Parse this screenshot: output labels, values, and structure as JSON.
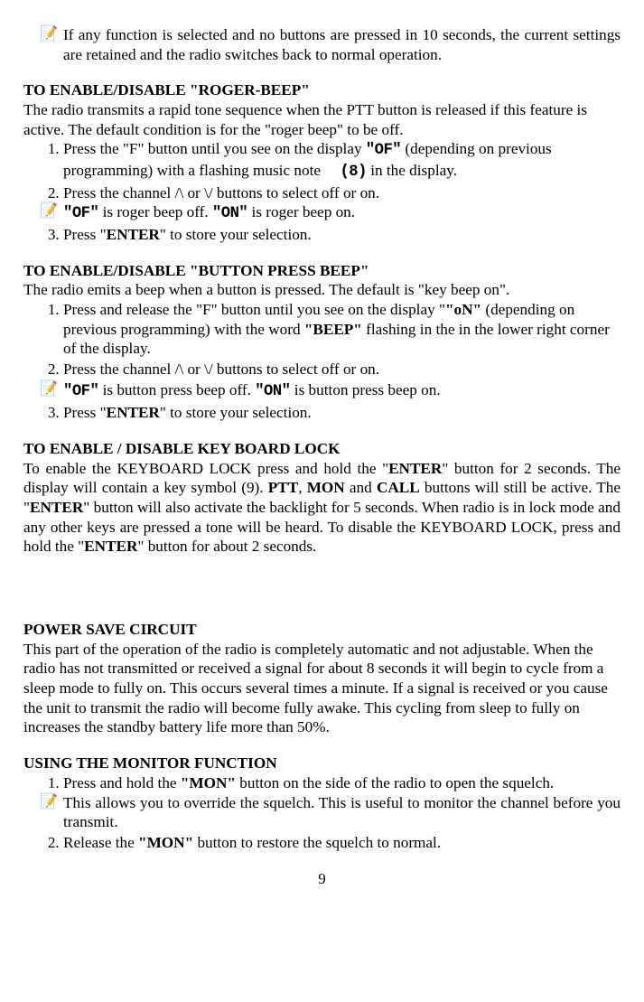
{
  "top_note": {
    "icon": "📝",
    "text": "If any function is selected and no buttons are pressed in 10 seconds, the current settings are retained and the radio switches back to normal operation."
  },
  "roger": {
    "heading": "TO ENABLE/DISABLE \"ROGER-BEEP\"",
    "intro": "The radio transmits a rapid tone sequence when the PTT button is released if this feature is active. The default condition is for the \"roger beep\" to be off.",
    "step1_a": "Press the \"F\" button until you see on the display ",
    "step1_of": "\"OF\"",
    "step1_b": " (depending on previous programming) with a flashing music note",
    "step1_eight": "(8)",
    "step1_c": " in the display.",
    "step2": "Press the channel /\\ or \\/ buttons to select off or on.",
    "note2_icon": "📝",
    "note2_of": "\"OF\"",
    "note2_mid": " is roger beep off. ",
    "note2_on": "\"ON\"",
    "note2_end": " is roger beep on.",
    "step3_a": "Press \"",
    "step3_enter": "ENTER",
    "step3_b": "\" to store your selection."
  },
  "button_beep": {
    "heading": "TO ENABLE/DISABLE \"BUTTON PRESS BEEP\"",
    "intro": "The radio emits a beep when a button is pressed. The default is \"key beep on\".",
    "step1_a": "Press and release the \"F\" button until you see on the display \"",
    "step1_on": "\"oN\"",
    "step1_b": " (depending on previous programming) with the word ",
    "step1_beep": "\"BEEP\"",
    "step1_c": " flashing in the in the lower right corner of the display.",
    "step2": "Press the channel /\\ or \\/ buttons to select off or on.",
    "outnote_icon": "📝",
    "outnote_of": "\"OF\"",
    "outnote_mid": " is button press  beep off. ",
    "outnote_on": "\"ON\"",
    "outnote_end": " is button press beep on.",
    "step3_a": "Press \"",
    "step3_enter": "ENTER",
    "step3_b": "\" to store your selection."
  },
  "lock": {
    "heading": "TO ENABLE / DISABLE KEY BOARD LOCK",
    "p_a": "To enable the KEYBOARD LOCK press and hold the \"",
    "p_en1": "ENTER",
    "p_b": "\" button for 2 seconds. The display will contain a key symbol (9). ",
    "p_ptt": "PTT",
    "p_c": ", ",
    "p_mon": "MON",
    "p_d": " and ",
    "p_call": "CALL",
    "p_e": " buttons will still be active. The \"",
    "p_en2": "ENTER",
    "p_f": "\" button will also activate the backlight for 5 seconds. When radio is in lock mode and any other keys are pressed a tone will be heard. To disable the KEYBOARD LOCK, press and hold the \"",
    "p_en3": "ENTER",
    "p_g": "\" button for about 2 seconds."
  },
  "power": {
    "heading": "POWER SAVE CIRCUIT",
    "text": "This part of the operation of the radio is completely automatic and not adjustable. When the radio has not transmitted or received a signal for about 8 seconds it will begin to cycle from a sleep mode to fully on. This occurs several times a minute. If a signal is received or you cause the unit to transmit the radio will become fully awake. This cycling from sleep to fully on increases the standby battery life more than 50%."
  },
  "monitor": {
    "heading": "USING THE MONITOR FUNCTION",
    "step1_a": "Press and hold the ",
    "step1_mon": "\"MON\"",
    "step1_b": " button on the side of the radio to open the squelch.",
    "note_icon": "📝",
    "note_text": "This allows you to override the squelch. This is useful to monitor the channel before you transmit.",
    "step2_a": "Release the ",
    "step2_mon": "\"MON\"",
    "step2_b": " button to restore the squelch to normal."
  },
  "page": "9"
}
